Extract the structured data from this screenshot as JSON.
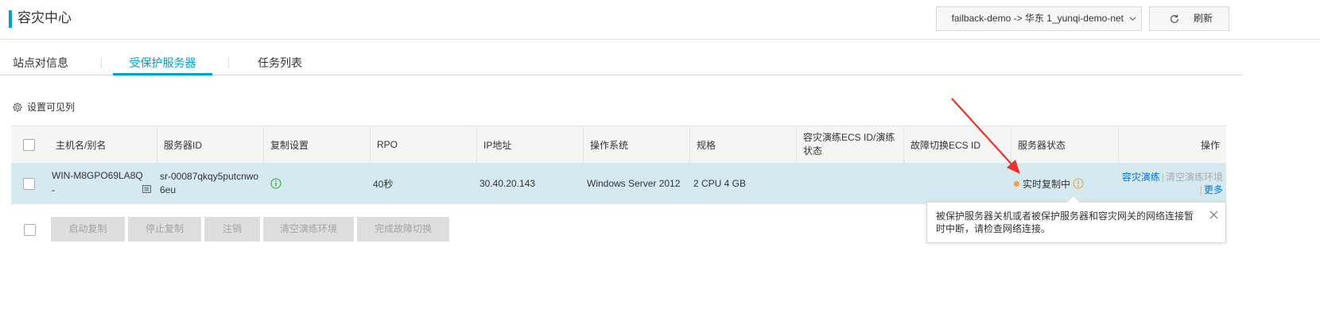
{
  "header": {
    "title": "容灾中心",
    "region_select": "failback-demo -> 华东 1_yunqi-demo-net",
    "refresh_label": "刷新"
  },
  "tabs": [
    {
      "label": "站点对信息",
      "active": false
    },
    {
      "label": "受保护服务器",
      "active": true
    },
    {
      "label": "任务列表",
      "active": false
    }
  ],
  "settings_label": "设置可见列",
  "table": {
    "columns": [
      "主机名/别名",
      "服务器ID",
      "复制设置",
      "RPO",
      "IP地址",
      "操作系统",
      "规格",
      "容灾演练ECS ID/演练状态",
      "故障切换ECS ID",
      "服务器状态",
      "操作"
    ],
    "rows": [
      {
        "host": "WIN-M8GPO69LA8Q",
        "alias": "-",
        "server_id": "sr-00087qkqy5putcnwo6eu",
        "rpo": "40秒",
        "ip": "30.40.20.143",
        "os": "Windows Server 2012",
        "spec": "2 CPU 4 GB",
        "drill_ecs": "",
        "failover_ecs": "",
        "status": "实时复制中",
        "ops": {
          "drill": "容灾演练",
          "clear_drill": "清空演练环境",
          "more": "更多"
        }
      }
    ]
  },
  "bulk_actions": [
    "启动复制",
    "停止复制",
    "注销",
    "清空演练环境",
    "完成故障切换"
  ],
  "tooltip": "被保护服务器关机或者被保护服务器和容灾网关的网络连接暂时中断，请检查网络连接。",
  "colors": {
    "accent": "#00a2ca",
    "status_warning": "#f2a13e",
    "link": "#0073d8",
    "annotation_arrow": "#e8322b"
  }
}
